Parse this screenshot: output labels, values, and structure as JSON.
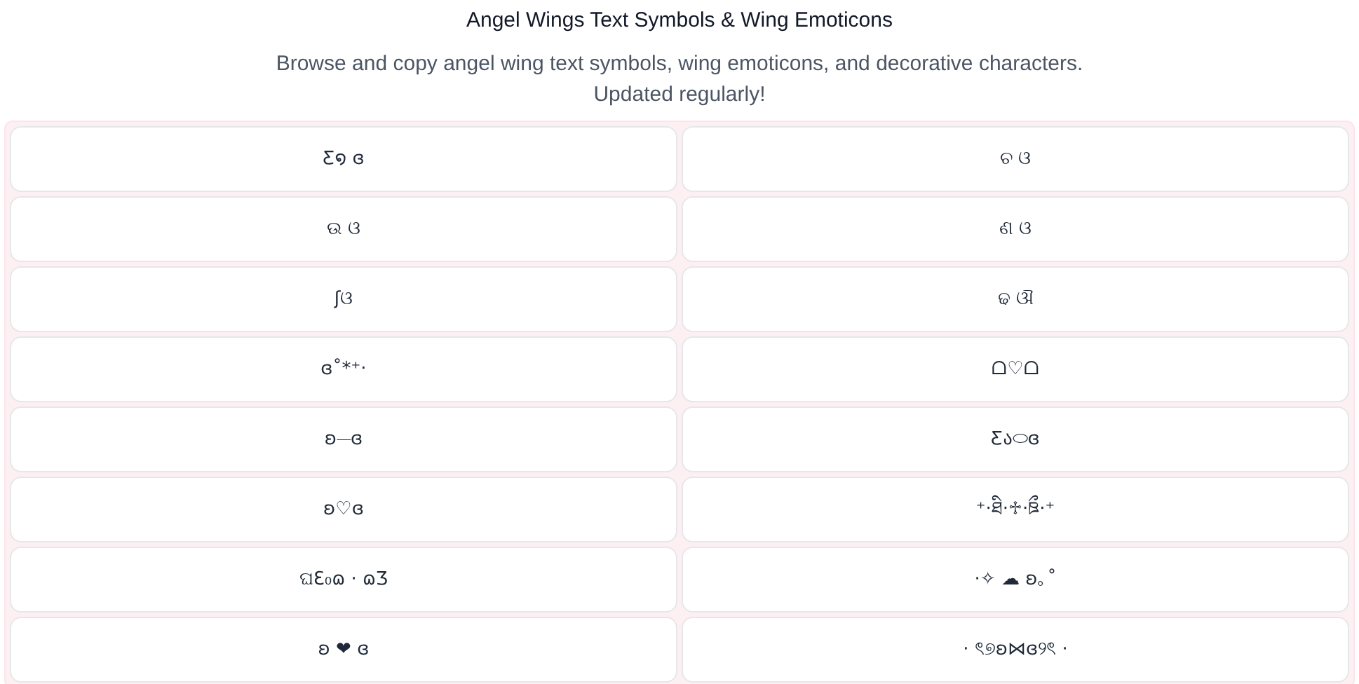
{
  "header": {
    "title": "Angel Wings Text Symbols & Wing Emoticons",
    "subtitle": "Browse and copy angel wing text symbols, wing emoticons, and decorative characters. Updated regularly!"
  },
  "symbols": [
    {
      "text": "Ƹ໑ ɞ"
    },
    {
      "text": "ଚ ଓ"
    },
    {
      "text": "ଉ ଓ"
    },
    {
      "text": "ଣ ଓ"
    },
    {
      "text": "ʃଓ"
    },
    {
      "text": "ଢ ଔ"
    },
    {
      "text": "ɞ˚*⁺‧"
    },
    {
      "text": "ᗝ♡ᗝ"
    },
    {
      "text": "ʚ⏤ɞ"
    },
    {
      "text": "Ƹა⬭ɞ"
    },
    {
      "text": "ʚ♡ɞ"
    },
    {
      "text": "⁺‧ཐི‧♱‧ཋྀ‧⁺"
    },
    {
      "text": "ଘƐ₀ɷ · ɷƷ"
    },
    {
      "text": "·✧ ☁ ʚ｡˚"
    },
    {
      "text": "ʚ ❤ ɞ"
    },
    {
      "text": "· ৎ୭ʚ⋈ɞ୨ৎ ·"
    }
  ]
}
